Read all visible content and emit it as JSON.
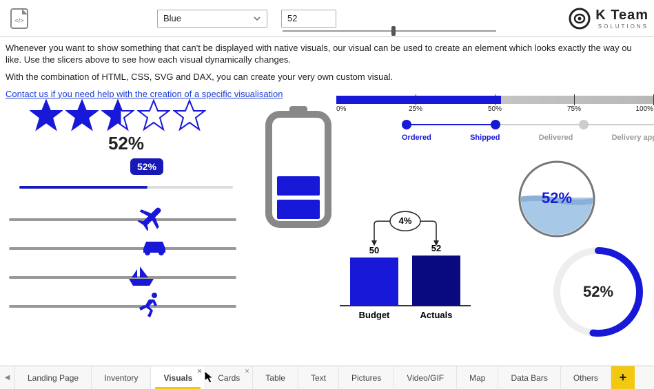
{
  "header": {
    "color_dropdown": "Blue",
    "value_input": "52",
    "logo_text": "K Team",
    "logo_sub": "SOLUTIONS"
  },
  "slider_header": {
    "pct": 52
  },
  "body": {
    "para1": "Whenever you want to show something that can't be displayed with native visuals, our visual can be used to create an element which looks exactly the way ou like. Use the slicers above to see how each visual dynamically changes.",
    "para2": "With the combination of HTML, CSS, SVG and DAX, you can create your very own custom visual.",
    "contact_link": "Contact us if you need help with the creation of a specific visualisation"
  },
  "stars": {
    "pct_label": "52%",
    "value": 2.6
  },
  "value_slider": {
    "tooltip": "52%",
    "pct": 60
  },
  "icon_sliders": [
    {
      "icon": "plane",
      "pct": 56
    },
    {
      "icon": "car",
      "pct": 58
    },
    {
      "icon": "boat",
      "pct": 52
    },
    {
      "icon": "runner",
      "pct": 56
    }
  ],
  "battery": {
    "pct": 52
  },
  "progress_bar": {
    "pct": 52,
    "ticks": [
      "0%",
      "25%",
      "50%",
      "75%",
      "100%"
    ]
  },
  "steps": {
    "items": [
      "Ordered",
      "Shipped",
      "Delivered",
      "Delivery approved"
    ],
    "active_index": 1
  },
  "chart_data": {
    "type": "bar",
    "categories": [
      "Budget",
      "Actuals"
    ],
    "values": [
      50,
      52
    ],
    "delta_label": "4%",
    "ylim": [
      0,
      100
    ]
  },
  "liquid": {
    "label": "52%",
    "pct": 52
  },
  "circle": {
    "label": "52%",
    "pct": 52
  },
  "tabs": {
    "items": [
      "Landing Page",
      "Inventory",
      "Visuals",
      "Cards",
      "Table",
      "Text",
      "Pictures",
      "Video/GIF",
      "Map",
      "Data Bars",
      "Others"
    ],
    "active": 2
  },
  "colors": {
    "accent": "#1818d8",
    "accent_dark": "#0a0a80"
  }
}
